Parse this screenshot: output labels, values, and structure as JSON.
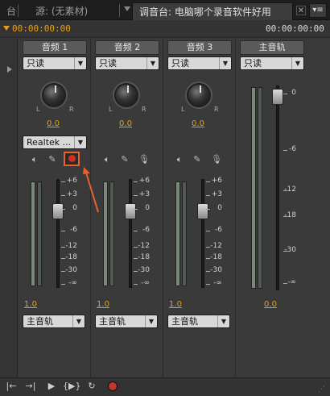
{
  "tabs": [
    {
      "label": "台",
      "active": false
    },
    {
      "label": "源: (无素材)",
      "active": false
    },
    {
      "label": "调音台: 电脑哪个录音软件好用",
      "active": true
    }
  ],
  "timecode_left": "00:00:00:00",
  "timecode_right": "00:00:00:00",
  "channels": [
    {
      "name": "音频 1",
      "mode": "只读",
      "pan": "0.0",
      "volume": "1.0",
      "output": "主音轨",
      "device": "Realtek ..."
    },
    {
      "name": "音频 2",
      "mode": "只读",
      "pan": "0.0",
      "volume": "1.0",
      "output": "主音轨"
    },
    {
      "name": "音频 3",
      "mode": "只读",
      "pan": "0.0",
      "volume": "1.0",
      "output": "主音轨"
    }
  ],
  "master": {
    "name": "主音轨",
    "mode": "只读",
    "volume": "0.0"
  },
  "knob_labels": {
    "l": "L",
    "r": "R"
  },
  "track_scale": [
    "+6",
    "+3",
    "0",
    "-6",
    "-12",
    "-18",
    "-30",
    "-∞"
  ],
  "master_scale": [
    "0",
    "-6",
    "-12",
    "-18",
    "-30",
    "-∞"
  ],
  "icons": {
    "speaker": "speaker-icon",
    "pencil": "record-arm-icon",
    "mic": "microphone-icon"
  },
  "transport": [
    "|←",
    "→|",
    "▶",
    "{▶}",
    "↻",
    "●"
  ],
  "colors": {
    "accent": "#e3a020",
    "highlight": "#e8602a"
  }
}
